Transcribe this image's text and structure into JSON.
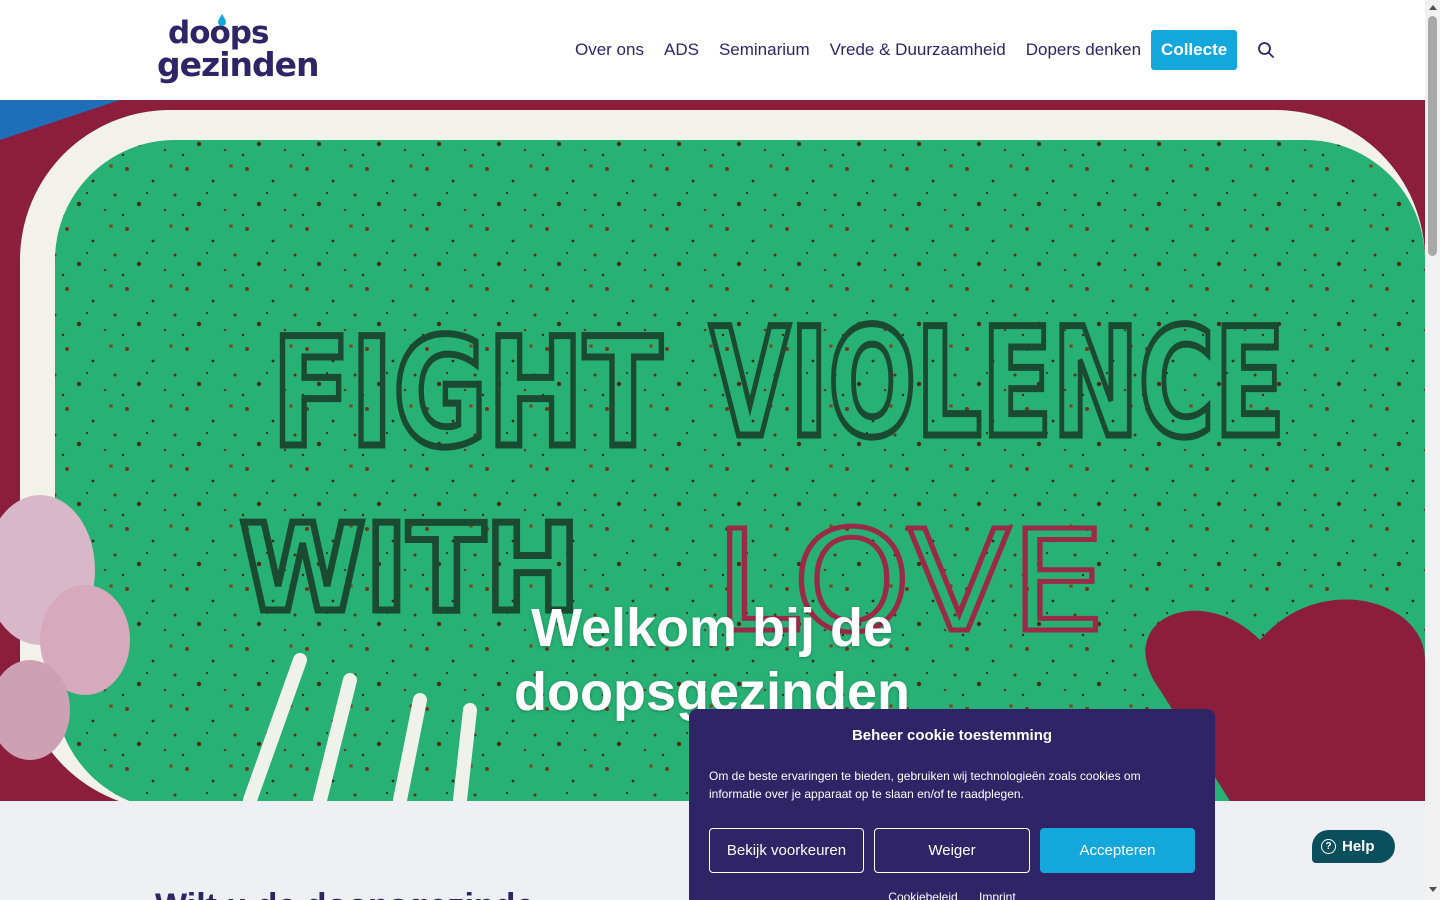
{
  "logo": {
    "line1": "doops",
    "line2": "gezinden",
    "drop_color": "#13a7dc"
  },
  "nav": {
    "items": [
      {
        "label": "Over ons"
      },
      {
        "label": "ADS"
      },
      {
        "label": "Seminarium"
      },
      {
        "label": "Vrede & Duurzaamheid"
      },
      {
        "label": "Dopers denken"
      }
    ],
    "collecte_label": "Collecte",
    "search_icon": "search-icon"
  },
  "hero": {
    "title_line1": "Welkom bij de",
    "title_line2": "doopsgezinden",
    "image_text_line1": "FIGHT VIOLENCE",
    "image_text_with": "WITH",
    "image_text_love": "LOVE"
  },
  "lower": {
    "heading": "Wilt u de doopsgezinde ..."
  },
  "cookie": {
    "title": "Beheer cookie toestemming",
    "text": "Om de beste ervaringen te bieden, gebruiken wij technologieën zoals cookies om informatie over je apparaat op te slaan en/of te raadplegen.",
    "btn_preferences": "Bekijk voorkeuren",
    "btn_deny": "Weiger",
    "btn_accept": "Accepteren",
    "link_policy": "Cookiebeleid",
    "link_imprint": "Imprint"
  },
  "help": {
    "label": "Help",
    "icon": "?"
  },
  "colors": {
    "brand_navy": "#2e2466",
    "accent_blue": "#13a7dc",
    "help_teal": "#0b4f5c"
  }
}
